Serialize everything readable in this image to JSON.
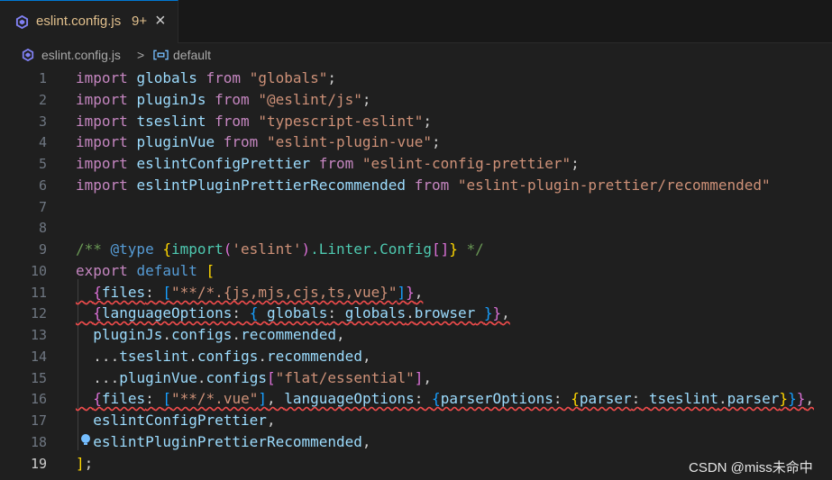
{
  "tab": {
    "filename": "eslint.config.js",
    "problems_badge": "9+",
    "close_glyph": "×",
    "icon": "eslint-purple-icon"
  },
  "breadcrumb": {
    "file": "eslint.config.js",
    "separator": ">",
    "symbol": "default",
    "file_icon": "eslint-purple-icon",
    "symbol_icon": "symbol-variable-icon"
  },
  "editor": {
    "active_line": "19",
    "line_numbers": [
      "1",
      "2",
      "3",
      "4",
      "5",
      "6",
      "7",
      "8",
      "9",
      "10",
      "11",
      "12",
      "13",
      "14",
      "15",
      "16",
      "17",
      "18",
      "19"
    ],
    "lines": [
      "import globals from \"globals\";",
      "import pluginJs from \"@eslint/js\";",
      "import tseslint from \"typescript-eslint\";",
      "import pluginVue from \"eslint-plugin-vue\";",
      "import eslintConfigPrettier from \"eslint-config-prettier\";",
      "import eslintPluginPrettierRecommended from \"eslint-plugin-prettier/recommended\"",
      "",
      "",
      "/** @type {import('eslint').Linter.Config[]} */",
      "export default [",
      "  {files: [\"**/*.{js,mjs,cjs,ts,vue}\"]},",
      "  {languageOptions: { globals: globals.browser }},",
      "  pluginJs.configs.recommended,",
      "  ...tseslint.configs.recommended,",
      "  ...pluginVue.configs[\"flat/essential\"],",
      "  {files: [\"**/*.vue\"], languageOptions: {parserOptions: {parser: tseslint.parser}}},",
      "  eslintConfigPrettier,",
      "  eslintPluginPrettierRecommended,",
      "];"
    ]
  },
  "watermark": "CSDN @miss未命中",
  "colors": {
    "background": "#1f1f1f",
    "keyword": "#569cd6",
    "control_keyword": "#c586c0",
    "variable": "#9cdcfe",
    "string": "#ce9178",
    "comment": "#6a9955",
    "type": "#4ec9b0",
    "bracket_gold": "#ffd700",
    "bracket_purple": "#da70d6",
    "bracket_blue": "#179fff",
    "error_squiggle": "#f14c4c",
    "tab_modified": "#e2c08d"
  }
}
